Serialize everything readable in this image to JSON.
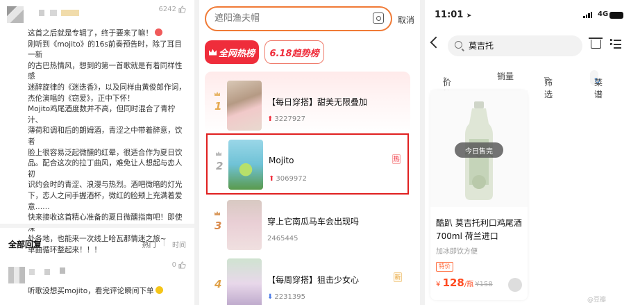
{
  "comment_panel": {
    "like_count": "6242",
    "comment_lines": [
      "这首之后就是专辑了，终于要来了嘛！",
      "刚听到《mojito》的16s前奏预告时，除了耳目一新",
      "的古巴热情风，想到的第一首歌就是有着同样性感",
      "迷醉旋律的《迷迭香》，以及同样由黄俊郎作词，",
      "杰伦演唱的《窃爱》，正中下怀！",
      "Mojito鸡尾酒度数并不高，但同时混合了青柠汁、",
      "薄荷和调和后的朗姆酒，青涩之中带着醉意，饮者",
      "脸上很容易泛起微醺的红晕，很适合作为夏日饮",
      "品。配合这次的拉丁曲风，难免让人想起与恋人初",
      "识约会时的青涩、浪漫与热烈。酒吧微暗的灯光",
      "下，恋人之间手握酒杯，微红的脸颊上充满着爱",
      "意……",
      "快来接收这首精心准备的夏日微醺指南吧！即使深",
      "处各地，也能来一次线上哈瓦那情迷之旅~",
      "单曲循环整起来！！！"
    ],
    "all_replies_label": "全部回复",
    "sort_hot": "热门",
    "sort_time": "时间",
    "reply_like_count": "0",
    "reply_text": "听歌没想买mojito，看完评论瞬间下单"
  },
  "ranking_panel": {
    "search_placeholder": "遮阳渔夫帽",
    "cancel_label": "取消",
    "tab_hot": "全网热榜",
    "tab_trend": "6.18趋势榜",
    "items": [
      {
        "rank": "1",
        "title": "【每日穿搭】甜美无限叠加",
        "count": "3227927",
        "trend": "up",
        "flag": ""
      },
      {
        "rank": "2",
        "title": "Mojito",
        "count": "3069972",
        "trend": "up",
        "flag": "热"
      },
      {
        "rank": "3",
        "title": "穿上它南瓜马车会出现吗",
        "count": "2465445",
        "trend": "",
        "flag": ""
      },
      {
        "rank": "4",
        "title": "【每周穿搭】狙击少女心",
        "count": "2231395",
        "trend": "down",
        "flag": "新"
      }
    ]
  },
  "shop_panel": {
    "time": "11:01",
    "network": "4G",
    "search_value": "莫吉托",
    "filter_price": "价格",
    "filter_sales": "销量",
    "filter_filter": "筛选",
    "chip_label": "菜谱",
    "sold_out_label": "今日售完",
    "product_name": "酷趴 莫吉托利口鸡尾酒700ml 荷兰进口",
    "product_sub": "加冰即饮方便",
    "badge": "特价",
    "currency": "¥",
    "price": "128",
    "price_unit": "/瓶",
    "orig_price": "¥158",
    "watermark": "@豆瓣"
  }
}
